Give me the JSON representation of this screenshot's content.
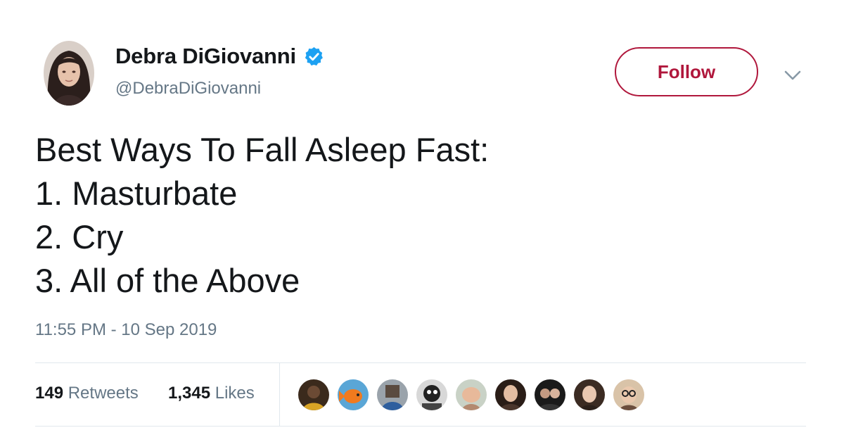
{
  "author": {
    "name": "Debra DiGiovanni",
    "handle": "@DebraDiGiovanni",
    "verified": true,
    "avatar_icon": "profile-photo"
  },
  "header": {
    "follow_label": "Follow",
    "menu_icon": "chevron-down-icon",
    "follow_color": "#b0173c"
  },
  "tweet": {
    "lines": [
      "Best Ways To Fall Asleep Fast:",
      "1. Masturbate",
      "2. Cry",
      "3. All of the Above"
    ],
    "timestamp": "11:55 PM - 10 Sep 2019"
  },
  "stats": {
    "retweets_count": "149",
    "retweets_label": "Retweets",
    "likes_count": "1,345",
    "likes_label": "Likes"
  },
  "likers": [
    {
      "icon": "liker-avatar-1"
    },
    {
      "icon": "liker-avatar-2"
    },
    {
      "icon": "liker-avatar-3"
    },
    {
      "icon": "liker-avatar-4"
    },
    {
      "icon": "liker-avatar-5"
    },
    {
      "icon": "liker-avatar-6"
    },
    {
      "icon": "liker-avatar-7"
    },
    {
      "icon": "liker-avatar-8"
    },
    {
      "icon": "liker-avatar-9"
    }
  ],
  "colors": {
    "text": "#14171a",
    "muted": "#657786",
    "verified": "#1da1f2",
    "divider": "#e1e8ed"
  }
}
